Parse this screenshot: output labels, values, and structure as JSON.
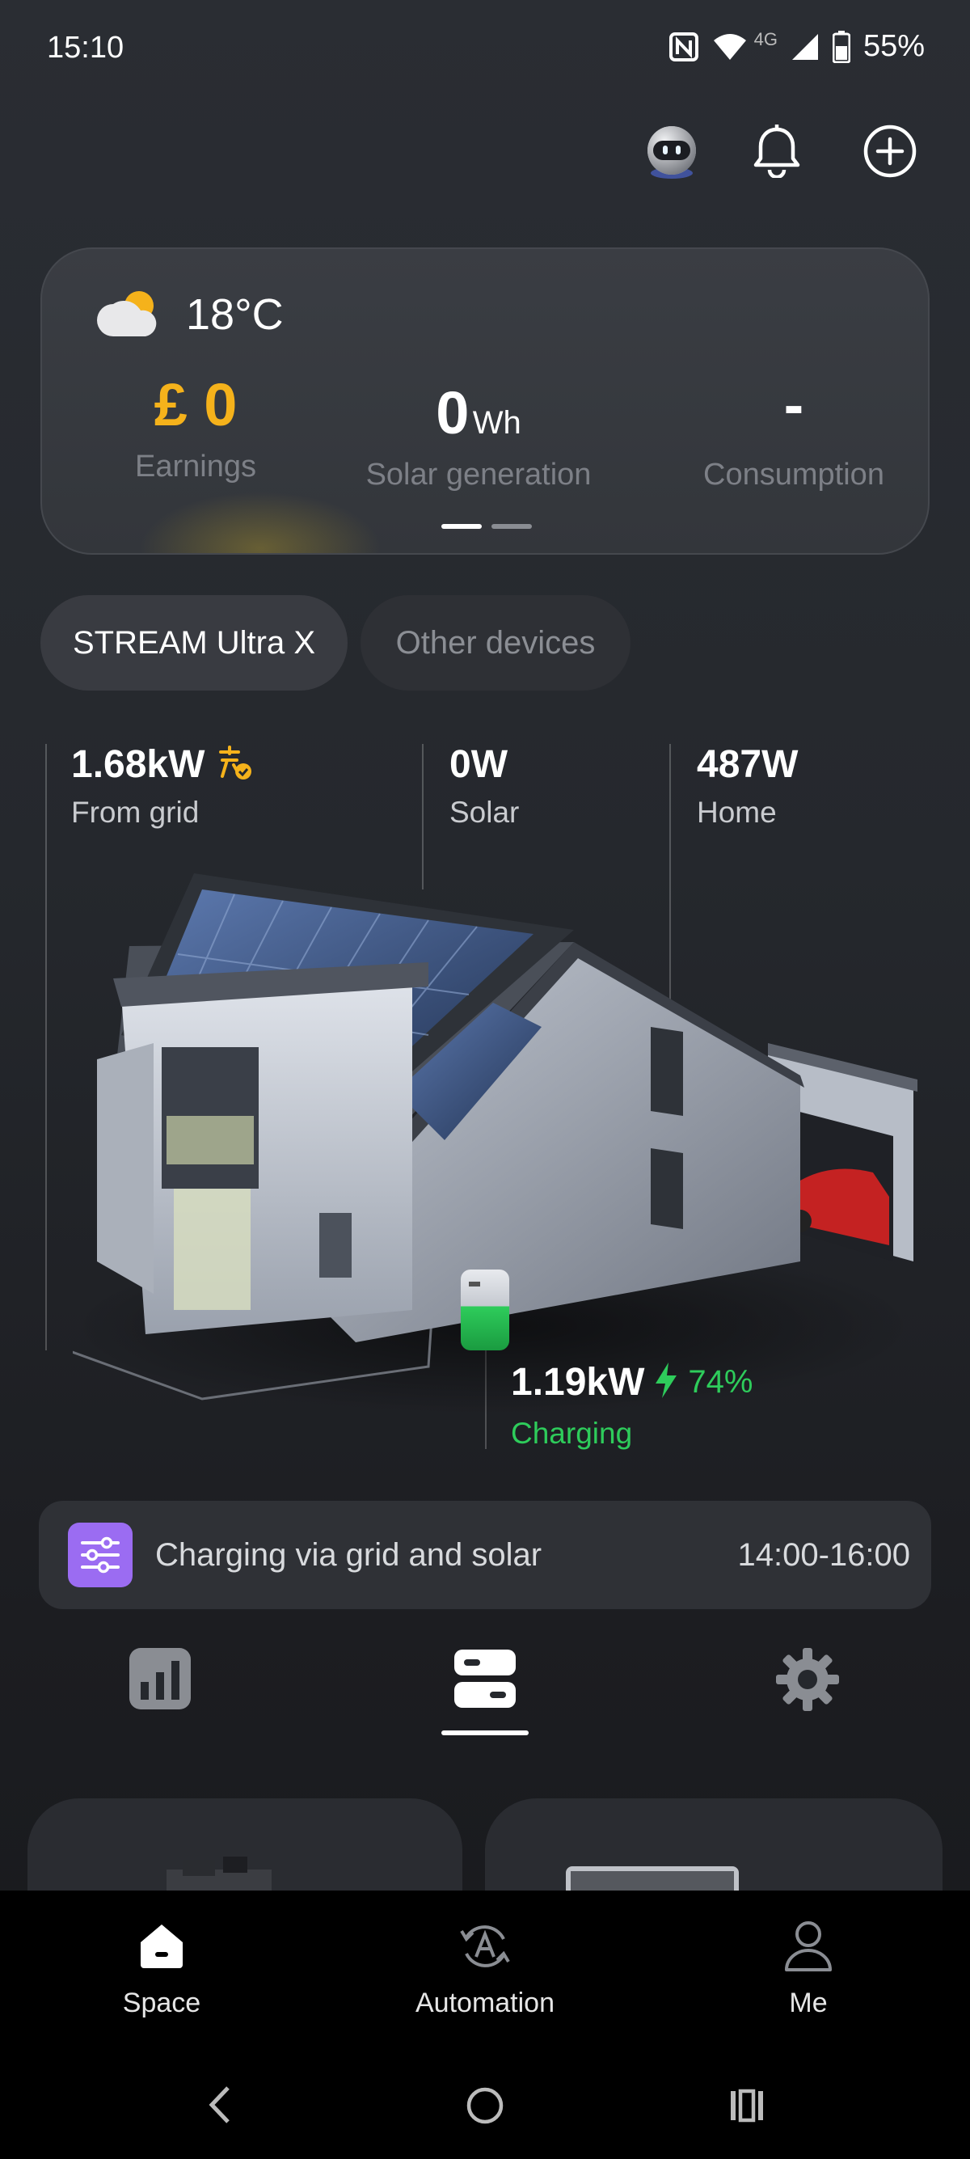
{
  "status_bar": {
    "time": "15:10",
    "network": "4G",
    "battery": "55%",
    "icons": [
      "nfc-icon",
      "wifi-icon",
      "signal-icon",
      "battery-icon"
    ]
  },
  "header": {
    "icons": [
      "assistant-robot-icon",
      "bell-icon",
      "add-circle-icon"
    ]
  },
  "weather_card": {
    "temperature": "18°C",
    "weather_icon": "partly-sunny-icon",
    "earnings": {
      "value": "£ 0",
      "label": "Earnings"
    },
    "solar_generation": {
      "value": "0",
      "unit": "Wh",
      "label": "Solar generation"
    },
    "consumption": {
      "value": "-",
      "label": "Consumption"
    },
    "page_count": 2,
    "active_page": 1
  },
  "device_tabs": [
    {
      "label": "STREAM Ultra X",
      "active": true
    },
    {
      "label": "Other devices",
      "active": false
    }
  ],
  "energy": {
    "grid": {
      "value": "1.68kW",
      "label": "From grid",
      "icon": "smart-tariff-icon"
    },
    "solar": {
      "value": "0W",
      "label": "Solar"
    },
    "home": {
      "value": "487W",
      "label": "Home"
    },
    "battery": {
      "value": "1.19kW",
      "percent": "74%",
      "status": "Charging",
      "icon": "bolt-icon"
    }
  },
  "schedule": {
    "icon": "sliders-icon",
    "text": "Charging via grid and solar",
    "time_range": "14:00-16:00"
  },
  "view_tabs": [
    {
      "icon": "bar-chart-icon",
      "active": false
    },
    {
      "icon": "device-list-icon",
      "active": true
    },
    {
      "icon": "gear-icon",
      "active": false
    }
  ],
  "bottom_nav": [
    {
      "label": "Space",
      "icon": "home-icon",
      "active": true
    },
    {
      "label": "Automation",
      "icon": "automation-icon",
      "active": false
    },
    {
      "label": "Me",
      "icon": "person-icon",
      "active": false
    }
  ],
  "system_nav": [
    "back-icon",
    "home-circle-icon",
    "recents-icon"
  ],
  "colors": {
    "accent_gold": "#f5b21b",
    "charging_green": "#2ecc5b",
    "schedule_icon_bg": "#9b6cf2"
  }
}
